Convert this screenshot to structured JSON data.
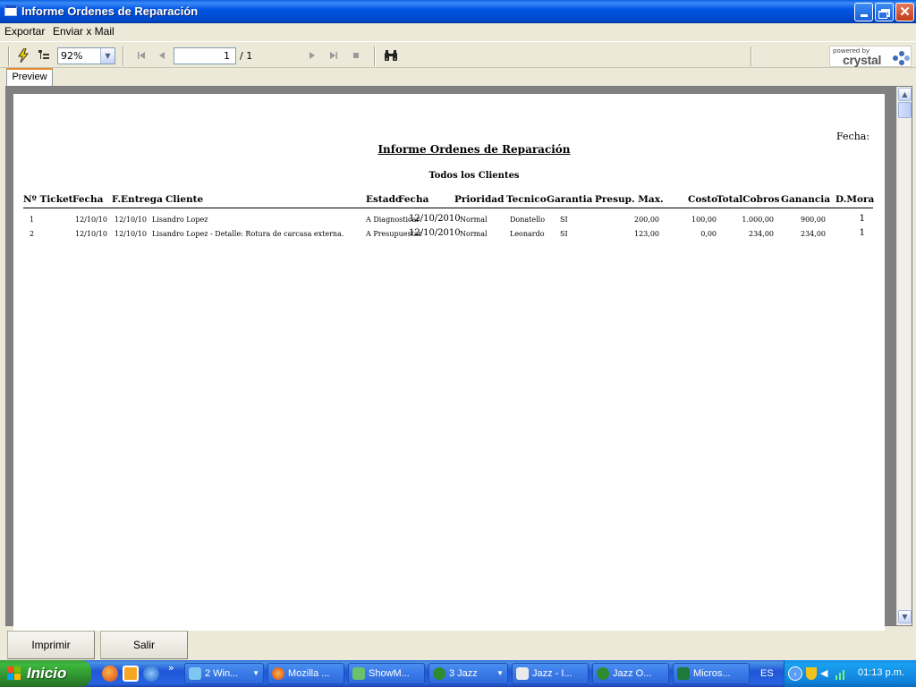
{
  "window": {
    "title": "Informe Ordenes de Reparación"
  },
  "menu": [
    "Exportar",
    "Enviar x Mail"
  ],
  "toolbar": {
    "zoom": "92%",
    "page_current": "1",
    "page_total": "/ 1",
    "logo_small": "powered by",
    "logo_text": "crystal"
  },
  "tab": "Preview",
  "report": {
    "fecha_label": "Fecha:",
    "title": "Informe Ordenes de Reparación",
    "subtitle": "Todos los Clientes",
    "headers": [
      "Nº Ticket",
      "Fecha",
      "F.Entrega",
      "Cliente",
      "Estado",
      "Fecha",
      "Prioridad",
      "Tecnico",
      "Garantia",
      "Presup. Max.",
      "Costo",
      "TotalCobros",
      "Ganancia",
      "D.Mora"
    ],
    "rows": [
      [
        "1",
        "12/10/10",
        "12/10/10",
        "Lisandro Lopez",
        "A Diagnosticar",
        "12/10/2010",
        "Normal",
        "Donatello",
        "SI",
        "200,00",
        "100,00",
        "1.000,00",
        "900,00",
        "1"
      ],
      [
        "2",
        "12/10/10",
        "12/10/10",
        "Lisandro Lopez - Detalle: Rotura de carcasa externa.",
        "A Presupuestar",
        "12/10/2010",
        "Normal",
        "Leonardo",
        "SI",
        "123,00",
        "0,00",
        "234,00",
        "234,00",
        "1"
      ]
    ]
  },
  "buttons": {
    "print": "Imprimir",
    "exit": "Salir"
  },
  "taskbar": {
    "start": "Inicio",
    "chevron": "»",
    "tasks": [
      "2 Win...",
      "Mozilla ...",
      "ShowM...",
      "3 Jazz",
      "Jazz - I...",
      "Jazz O...",
      "Micros..."
    ],
    "lang": "ES",
    "clock": "01:13 p.m."
  }
}
